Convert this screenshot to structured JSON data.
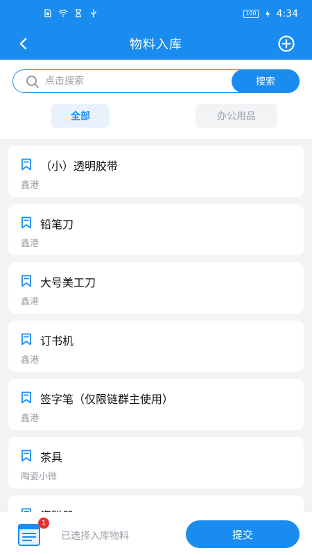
{
  "status_bar": {
    "time": "4:34",
    "battery": "100",
    "icons": [
      "sim-card-icon",
      "wifi-icon",
      "hourglass-icon",
      "usb-icon",
      "charging-icon"
    ]
  },
  "header": {
    "title": "物料入库",
    "back_icon": "back-arrow-icon",
    "add_icon": "add-circle-icon"
  },
  "search": {
    "placeholder": "点击搜索",
    "value": "",
    "button_label": "搜索"
  },
  "tabs": [
    {
      "label": "全部",
      "active": true
    },
    {
      "label": "办公用品",
      "active": false
    }
  ],
  "items": [
    {
      "name": "（小）透明胶带",
      "brand": "鑫港"
    },
    {
      "name": "铅笔刀",
      "brand": "鑫港"
    },
    {
      "name": "大号美工刀",
      "brand": "鑫港"
    },
    {
      "name": "订书机",
      "brand": "鑫港"
    },
    {
      "name": "签字笔（仅限链群主使用）",
      "brand": "鑫港"
    },
    {
      "name": "茶具",
      "brand": "陶瓷小微"
    },
    {
      "name": "资料册",
      "brand": ""
    }
  ],
  "bottom": {
    "badge_count": "1",
    "selected_text": "已选择入库物料",
    "submit_label": "提交"
  },
  "colors": {
    "primary": "#1a8cf0",
    "badge": "#e8302c"
  }
}
